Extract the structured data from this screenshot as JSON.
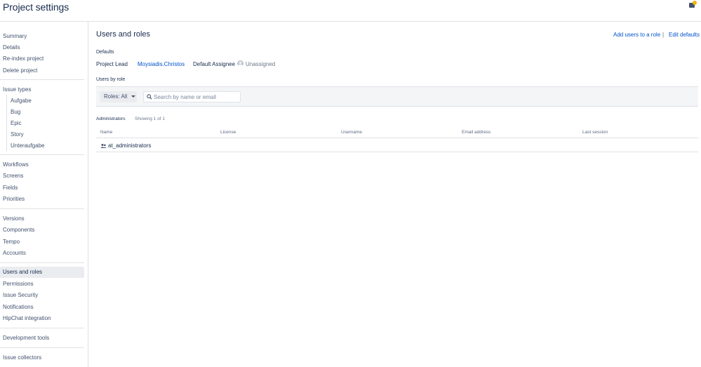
{
  "header": {
    "title": "Project settings"
  },
  "sidebar": {
    "items": [
      {
        "label": "Summary"
      },
      {
        "label": "Details"
      },
      {
        "label": "Re-index project"
      },
      {
        "label": "Delete project"
      },
      {
        "label": "Issue types"
      },
      {
        "label": "Aufgabe"
      },
      {
        "label": "Bug"
      },
      {
        "label": "Epic"
      },
      {
        "label": "Story"
      },
      {
        "label": "Unteraufgabe"
      },
      {
        "label": "Workflows"
      },
      {
        "label": "Screens"
      },
      {
        "label": "Fields"
      },
      {
        "label": "Priorities"
      },
      {
        "label": "Versions"
      },
      {
        "label": "Components"
      },
      {
        "label": "Tempo"
      },
      {
        "label": "Accounts"
      },
      {
        "label": "Users and roles"
      },
      {
        "label": "Permissions"
      },
      {
        "label": "Issue Security"
      },
      {
        "label": "Notifications"
      },
      {
        "label": "HipChat integration"
      },
      {
        "label": "Development tools"
      },
      {
        "label": "Issue collectors"
      }
    ]
  },
  "main": {
    "title": "Users and roles",
    "add_users_label": "Add users to a role",
    "separator": "|",
    "edit_defaults_label": "Edit defaults",
    "defaults_label": "Defaults",
    "project_lead_label": "Project Lead",
    "project_lead_value": "Moysiadis.Christos",
    "default_assignee_label": "Default Assignee",
    "default_assignee_value": "Unassigned",
    "users_by_role_label": "Users by role",
    "roles_filter_label": "Roles: All",
    "search_placeholder": "Search by name or email",
    "role_section_name": "Administrators",
    "role_section_count": "Showing 1 of 1",
    "columns": [
      "Name",
      "License",
      "Username",
      "Email address",
      "Last session"
    ],
    "rows": [
      {
        "name": "at_administrators"
      }
    ]
  },
  "colors": {
    "link": "#0052cc",
    "text": "#172b4d",
    "active_bg": "#ebecf0",
    "badge": "#f5b400"
  }
}
